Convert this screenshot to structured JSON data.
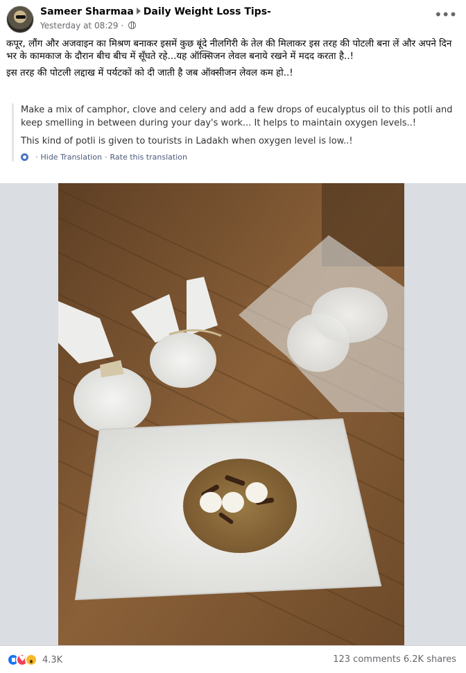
{
  "post": {
    "author": "Sameer Sharmaa",
    "group": "Daily Weight Loss Tips-",
    "timestamp": "Yesterday at 08:29",
    "more_label": "•••",
    "text_paragraphs": [
      "कपूर, लौंग और अजवाइन का  मिश्रण बनाकर इसमें कुछ बूंदे नीलगिरी के तेल की मिलाकर इस तरह की पोटली बना लें और अपने दिन भर के कामकाज के दौरान बीच बीच में सूँघते रहे...यह ऑक्सिजन लेवल बनाये रखने में मदद करता है..!",
      "इस तरह की पोटली लद्दाख में पर्यटकों को दी जाती है जब ऑक्सीजन लेवल कम हो..!"
    ],
    "translation": {
      "paragraphs": [
        "Make a mix of camphor, clove and celery and add a few drops of eucalyptus oil to this potli and keep smelling in between during your day's work... It helps to maintain oxygen levels..!",
        "This kind of potli is given to tourists in Ladakh when oxygen level is low..!"
      ],
      "hide_label": "Hide Translation",
      "separator": "·",
      "rate_label": "Rate this translation"
    }
  },
  "footer": {
    "reaction_count": "4.3K",
    "comments": "123 comments",
    "shares": "6.2K shares"
  },
  "colors": {
    "like": "#1877f2",
    "love": "#f33e58",
    "wow": "#f7b928",
    "secondary_text": "#65676b",
    "photo_backdrop": "#dadde1"
  }
}
